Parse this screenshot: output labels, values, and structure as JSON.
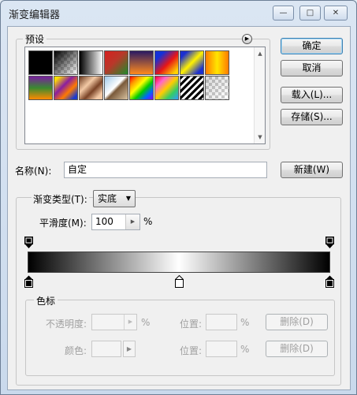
{
  "window": {
    "title": "渐变编辑器"
  },
  "title_buttons": {
    "minimize": "—",
    "maximize": "□",
    "close": "✕"
  },
  "presets": {
    "legend": "预设",
    "swatches": [
      {
        "name": "foreground-to-background",
        "style": "linear-gradient(135deg,#000,#000)"
      },
      {
        "name": "foreground-to-transparent",
        "style": "linear-gradient(135deg,#000 0%, rgba(0,0,0,0) 100%)"
      },
      {
        "name": "black-white",
        "style": "linear-gradient(to right,#000,#fff)"
      },
      {
        "name": "red-green",
        "style": "linear-gradient(135deg,#d61f1f 0%,#b8382a 45%,#1f8b2b 100%)"
      },
      {
        "name": "violet-orange",
        "style": "linear-gradient(to bottom,#2b1a63,#ff8a1c)"
      },
      {
        "name": "blue-red-yellow",
        "style": "linear-gradient(135deg,#1530d8 20%,#e81616 55%,#ffd400 90%)"
      },
      {
        "name": "blue-yellow-blue",
        "style": "linear-gradient(135deg,#1b2fd0 15%,#fff200 50%,#1b2fd0 85%)"
      },
      {
        "name": "orange-yellow-orange",
        "style": "linear-gradient(to right,#ff7a00,#ffe600,#ff7a00)"
      },
      {
        "name": "violet-green-orange",
        "style": "linear-gradient(to bottom,#7a1ea0,#3a8a30,#ff8a00)"
      },
      {
        "name": "yellow-violet-orange-blue",
        "style": "linear-gradient(135deg,#ffe000 10%,#8a1ea0 40%,#ff7a00 65%,#1a3bd0 90%)"
      },
      {
        "name": "copper",
        "style": "linear-gradient(135deg,#6b3a1f,#f3c9a5 35%,#7a4326 60%,#f3c9a5 85%)"
      },
      {
        "name": "chrome",
        "style": "linear-gradient(135deg,#9fc8e8 0%,#ffffff 45%,#7a5a3a 55%,#d8c2a0 100%)"
      },
      {
        "name": "spectrum",
        "style": "linear-gradient(135deg,#ff0000,#ff9900,#ffff00,#00cc00,#0066ff,#8a00ff)"
      },
      {
        "name": "transparent-rainbow",
        "style": "linear-gradient(135deg,#ff0033,#ff66cc,#ffcc00,#33cc66,#3399ff)"
      },
      {
        "name": "transparent-stripes",
        "style": "repeating-linear-gradient(135deg,#000 0px,#000 3px,#fff 3px,#fff 6px)"
      },
      {
        "name": "neutral-density",
        "style": "linear-gradient(135deg,rgba(0,0,0,0.15),rgba(0,0,0,0))"
      }
    ]
  },
  "buttons": {
    "ok": "确定",
    "cancel": "取消",
    "load": "载入(L)...",
    "save": "存储(S)...",
    "new": "新建(W)",
    "delete_opacity": "删除(D)",
    "delete_color": "删除(D)"
  },
  "name_field": {
    "label": "名称(N):",
    "value": "自定"
  },
  "gradient_type": {
    "label": "渐变类型(T):",
    "value": "实底"
  },
  "smoothness": {
    "label": "平滑度(M):",
    "value": "100",
    "unit": "%"
  },
  "color_stops": {
    "legend": "色标",
    "opacity_label": "不透明度:",
    "opacity_unit": "%",
    "location_label": "位置:",
    "location_unit": "%",
    "color_label": "颜色:",
    "location2_label": "位置:",
    "location2_unit": "%"
  },
  "gradient": {
    "colors": [
      "#000000",
      "#ffffff",
      "#000000"
    ]
  }
}
